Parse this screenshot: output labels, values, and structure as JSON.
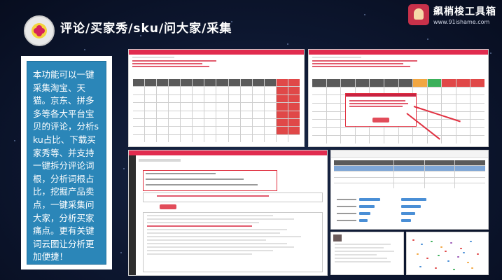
{
  "header": {
    "title": "评论/买家秀/sku/问大家/采集"
  },
  "brand": {
    "name": "飙梢梭工具箱",
    "url": "www.91ishame.com"
  },
  "left_panel": {
    "text": "本功能可以一键采集淘宝、天猫。京东、拼多多等各大平台宝贝的评论，分析sku占比、下载买家秀等、并支持一键拆分评论词根，分析词根占比，挖掘产品卖点，一键采集问大家，分析买家痛点。更有关键词云图让分析更加便捷！"
  },
  "icons": {
    "logo": "flower-logo-icon",
    "brand": "mascot-badge-icon"
  },
  "colors": {
    "background": "#0d1730",
    "accent_red": "#e12c4f",
    "panel_blue": "#2b86b8"
  }
}
